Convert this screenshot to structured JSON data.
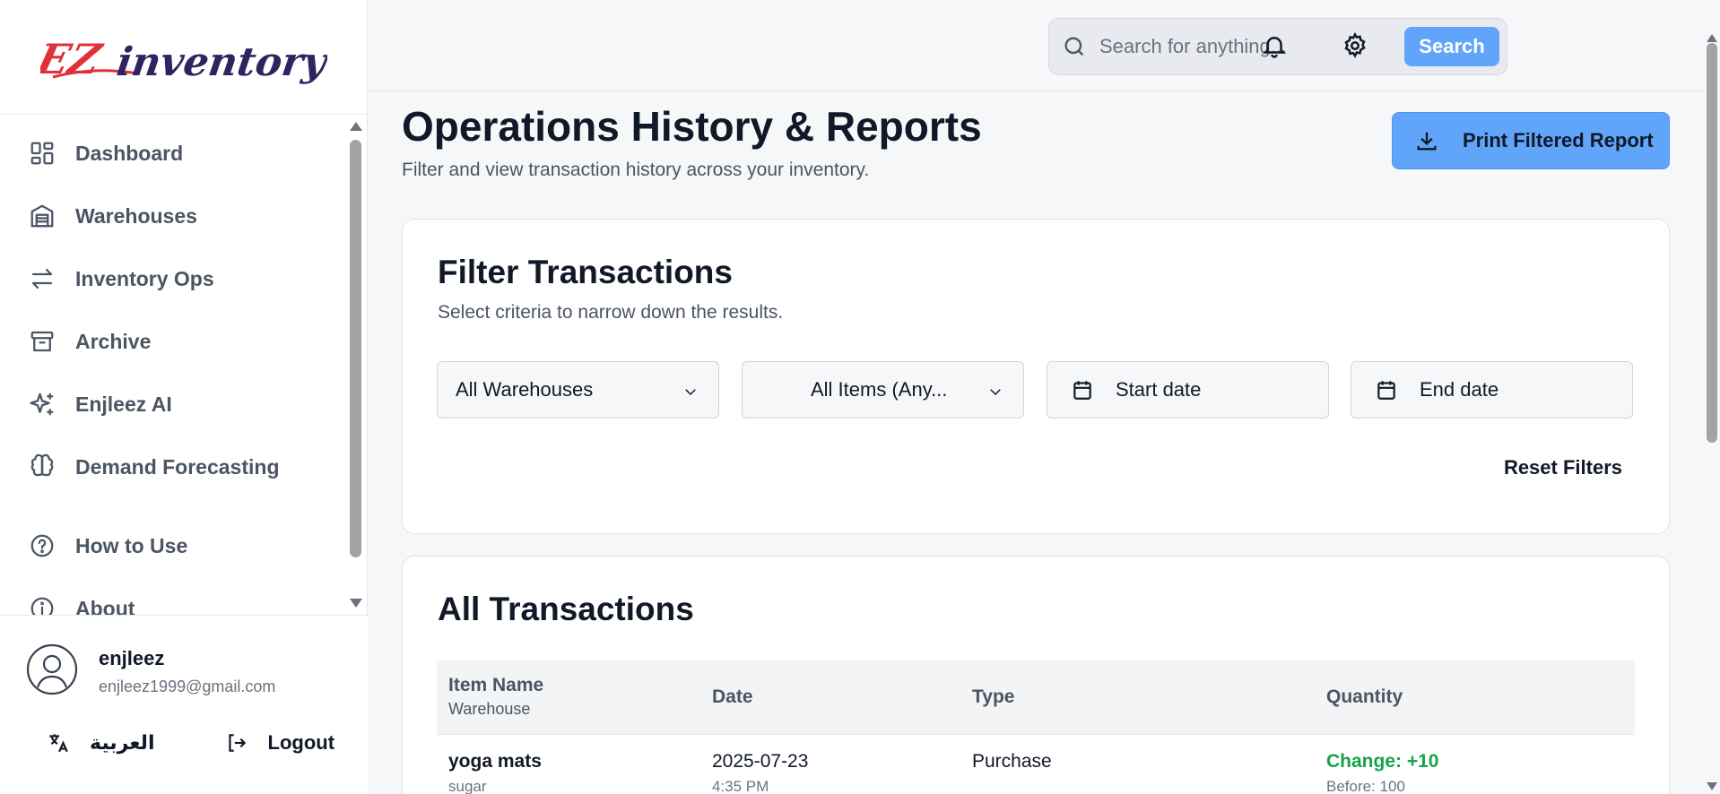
{
  "app": {
    "logo_text": "EZinventory"
  },
  "sidebar": {
    "items": [
      {
        "label": "Dashboard",
        "icon": "dashboard-icon"
      },
      {
        "label": "Warehouses",
        "icon": "warehouse-icon"
      },
      {
        "label": "Inventory Ops",
        "icon": "arrows-swap-icon"
      },
      {
        "label": "Archive",
        "icon": "archive-icon"
      },
      {
        "label": "Enjleez AI",
        "icon": "sparkles-icon"
      },
      {
        "label": "Demand Forecasting",
        "icon": "brain-icon"
      },
      {
        "label": "How to Use",
        "icon": "help-circle-icon"
      },
      {
        "label": "About",
        "icon": "info-icon"
      }
    ],
    "user": {
      "name": "enjleez",
      "email": "enjleez1999@gmail.com"
    },
    "language_label": "العربية",
    "logout_label": "Logout"
  },
  "header": {
    "search_placeholder": "Search for anything...",
    "search_button": "Search"
  },
  "page": {
    "title": "Operations History & Reports",
    "subtitle": "Filter and view transaction history across your inventory.",
    "print_button": "Print Filtered Report"
  },
  "filters": {
    "title": "Filter Transactions",
    "subtitle": "Select criteria to narrow down the results.",
    "warehouse_select": "All Warehouses",
    "items_select": "All Items (Any...",
    "start_date": "Start date",
    "end_date": "End date",
    "reset_button": "Reset Filters"
  },
  "transactions": {
    "title": "All Transactions",
    "columns": {
      "item": "Item Name",
      "item_sub": "Warehouse",
      "date": "Date",
      "type": "Type",
      "quantity": "Quantity"
    },
    "rows": [
      {
        "item": "yoga mats",
        "warehouse": "sugar",
        "date": "2025-07-23",
        "time": "4:35 PM",
        "type": "Purchase",
        "change": "Change: +10",
        "before": "Before: 100"
      }
    ]
  },
  "colors": {
    "accent": "#60a5fa",
    "positive": "#16a34a"
  }
}
